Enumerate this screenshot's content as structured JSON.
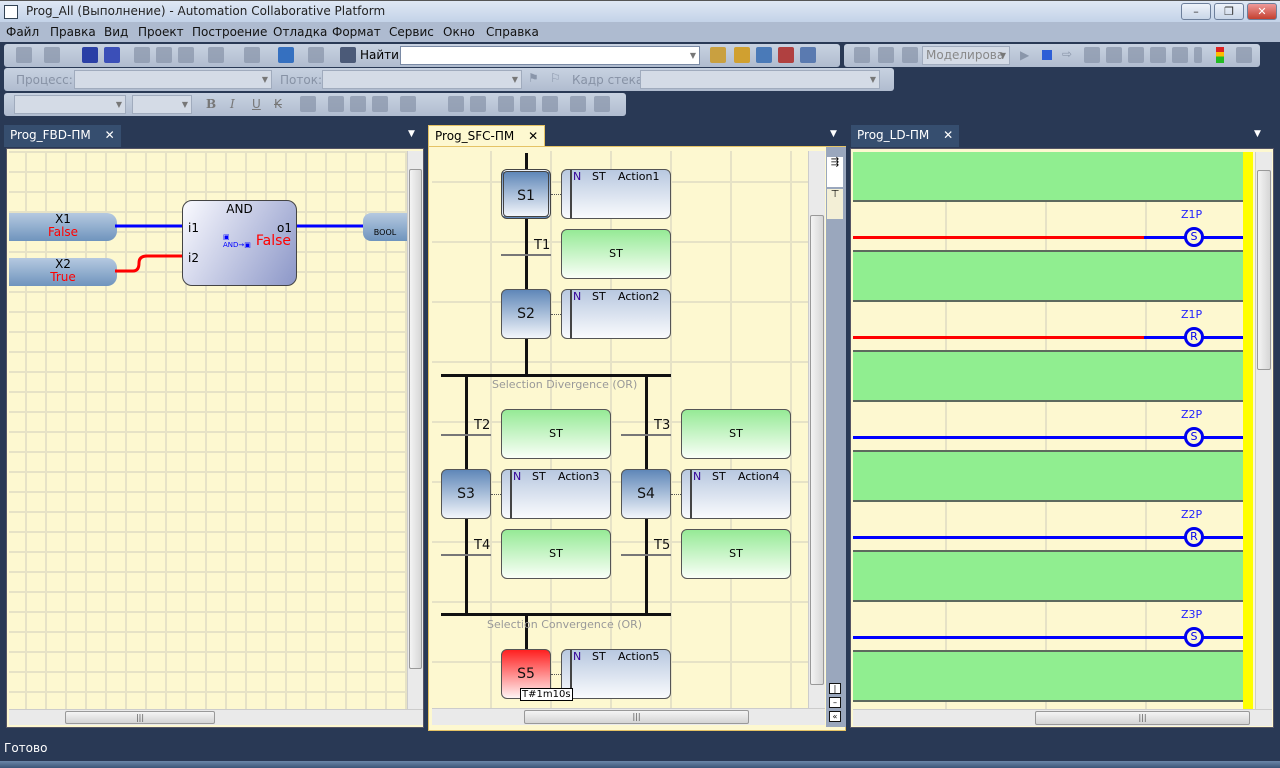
{
  "window": {
    "title": "Prog_All (Выполнение) - Automation Collaborative Platform",
    "min": "–",
    "restore": "❐",
    "close": "✕"
  },
  "menu": [
    "Файл",
    "Правка",
    "Вид",
    "Проект",
    "Построение",
    "Отладка",
    "Формат",
    "Сервис",
    "Окно",
    "Справка"
  ],
  "toolbar1": {
    "find_label": "Найти",
    "find_value": "",
    "mode_value": "Моделирова"
  },
  "toolbar2": {
    "process_label": "Процесс:",
    "process_value": "",
    "thread_label": "Поток:",
    "thread_value": "",
    "stack_label": "Кадр стека:",
    "stack_value": ""
  },
  "toolbar3": {
    "bold": "B",
    "italic": "I",
    "underline": "U",
    "strike": "K"
  },
  "panels": {
    "fbd": {
      "tab": "Prog_FBD-ПМ",
      "close": "✕",
      "inputs": [
        {
          "name": "X1",
          "value": "False",
          "wire": "#0000ff"
        },
        {
          "name": "X2",
          "value": "True",
          "wire": "#ff0000"
        }
      ],
      "block": {
        "type": "AND",
        "in1": "i1",
        "in2": "i2",
        "out": "o1",
        "value": "False"
      },
      "output": {
        "type": "BOOL"
      }
    },
    "sfc": {
      "tab": "Prog_SFC-ПМ",
      "close": "✕",
      "divergence": "Selection Divergence (OR)",
      "convergence": "Selection Convergence (OR)",
      "steps": [
        {
          "id": "S1",
          "state": "initial",
          "action": {
            "q": "N",
            "lang": "ST",
            "name": "Action1"
          }
        },
        {
          "id": "S2",
          "state": "normal",
          "action": {
            "q": "N",
            "lang": "ST",
            "name": "Action2"
          }
        },
        {
          "id": "S3",
          "state": "normal",
          "action": {
            "q": "N",
            "lang": "ST",
            "name": "Action3"
          }
        },
        {
          "id": "S4",
          "state": "normal",
          "action": {
            "q": "N",
            "lang": "ST",
            "name": "Action4"
          }
        },
        {
          "id": "S5",
          "state": "active",
          "timer": "T#1m10s",
          "action": {
            "q": "N",
            "lang": "ST",
            "name": "Action5"
          }
        }
      ],
      "transitions": [
        {
          "id": "T1",
          "lang": "ST"
        },
        {
          "id": "T2",
          "lang": "ST"
        },
        {
          "id": "T3",
          "lang": "ST"
        },
        {
          "id": "T4",
          "lang": "ST"
        },
        {
          "id": "T5",
          "lang": "ST"
        }
      ]
    },
    "ld": {
      "tab": "Prog_LD-ПМ",
      "close": "✕",
      "rungs": [
        {
          "var": "Z1P",
          "coil": "S",
          "left_color": "#ff0000",
          "right_color": "#0000ff"
        },
        {
          "var": "Z1P",
          "coil": "R",
          "left_color": "#ff0000",
          "right_color": "#0000ff"
        },
        {
          "var": "Z2P",
          "coil": "S",
          "left_color": "#0000ff",
          "right_color": "#0000ff"
        },
        {
          "var": "Z2P",
          "coil": "R",
          "left_color": "#0000ff",
          "right_color": "#0000ff"
        },
        {
          "var": "Z3P",
          "coil": "S",
          "left_color": "#0000ff",
          "right_color": "#0000ff"
        },
        {
          "var": "Z3P",
          "coil": "",
          "left_color": "",
          "right_color": ""
        }
      ],
      "power_rail_color": "#ffff00"
    }
  },
  "status": {
    "text": "Готово"
  }
}
